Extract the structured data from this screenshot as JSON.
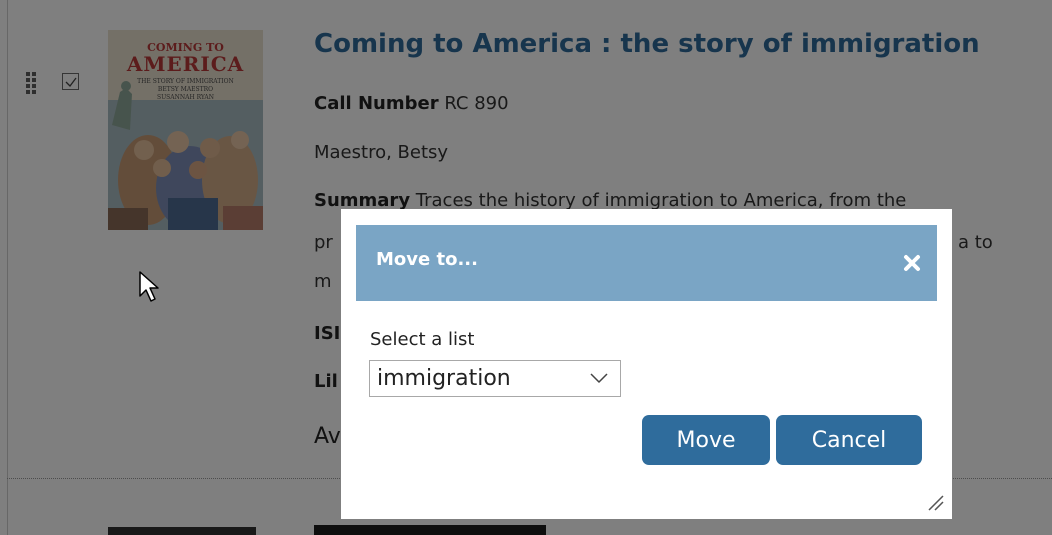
{
  "record": {
    "title": "Coming to America : the story of immigration",
    "call_number_label": "Call Number",
    "call_number": "RC 890",
    "author": "Maestro, Betsy",
    "summary_label": "Summary",
    "summary_line1": "Traces the history of immigration to America, from the",
    "summary_line2_start": "pr",
    "summary_line2_end": "a to",
    "summary_line3_start": "m",
    "isbn_label_partial": "ISI",
    "library_label_partial": "Lil",
    "availability_partial": "Av"
  },
  "cover": {
    "title_line1": "COMING TO",
    "title_line2": "AMERICA",
    "subtitle": "THE STORY OF IMMIGRATION",
    "author": "BETSY MAESTRO",
    "illustrator": "SUSANNAH RYAN"
  },
  "dialog": {
    "title": "Move to...",
    "select_label": "Select a list",
    "selected_list": "immigration",
    "move_label": "Move",
    "cancel_label": "Cancel"
  },
  "colors": {
    "header": "#7aa5c5",
    "button": "#2f6c9c",
    "title_link": "#2e6a9a"
  },
  "icons": {
    "close": "close-icon",
    "dropdown": "chevron-down-icon",
    "resize": "resize-handle-icon",
    "drag": "drag-handle-icon",
    "checkbox": "checkbox-icon",
    "cursor": "mouse-pointer-icon"
  }
}
